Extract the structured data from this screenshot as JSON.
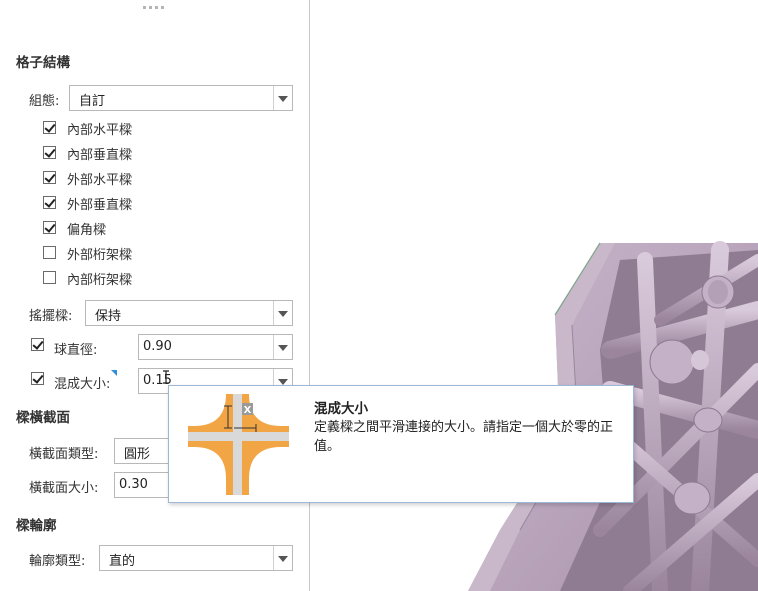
{
  "panel": {
    "lattice_section": {
      "title": "格子結構",
      "config_label": "組態:",
      "config_value": "自訂",
      "checkboxes": [
        {
          "label": "內部水平樑",
          "checked": true
        },
        {
          "label": "內部垂直樑",
          "checked": true
        },
        {
          "label": "外部水平樑",
          "checked": true
        },
        {
          "label": "外部垂直樑",
          "checked": true
        },
        {
          "label": "偏角樑",
          "checked": true
        },
        {
          "label": "外部桁架樑",
          "checked": false
        },
        {
          "label": "內部桁架樑",
          "checked": false
        }
      ],
      "swing_label": "搖擺樑:",
      "swing_value": "保持",
      "ball_label": "球直徑:",
      "ball_checked": true,
      "ball_value": "0.90",
      "blend_label": "混成大小:",
      "blend_checked": true,
      "blend_value": "0.15"
    },
    "cross_section": {
      "title": "樑橫截面",
      "type_label": "橫截面類型:",
      "type_value": "圓形",
      "size_label": "橫截面大小:",
      "size_value": "0.30"
    },
    "profile_section": {
      "title": "樑輪廓",
      "type_label": "輪廓類型:",
      "type_value": "直的"
    }
  },
  "tooltip": {
    "title": "混成大小",
    "text": "定義樑之間平滑連接的大小。請指定一個大於零的正值。",
    "image_label": "X"
  },
  "colors": {
    "model": "#b9a3bd",
    "model_shadow": "#8d7990",
    "tooltip_orange": "#f2a545",
    "tooltip_gray": "#d9d9d9"
  }
}
